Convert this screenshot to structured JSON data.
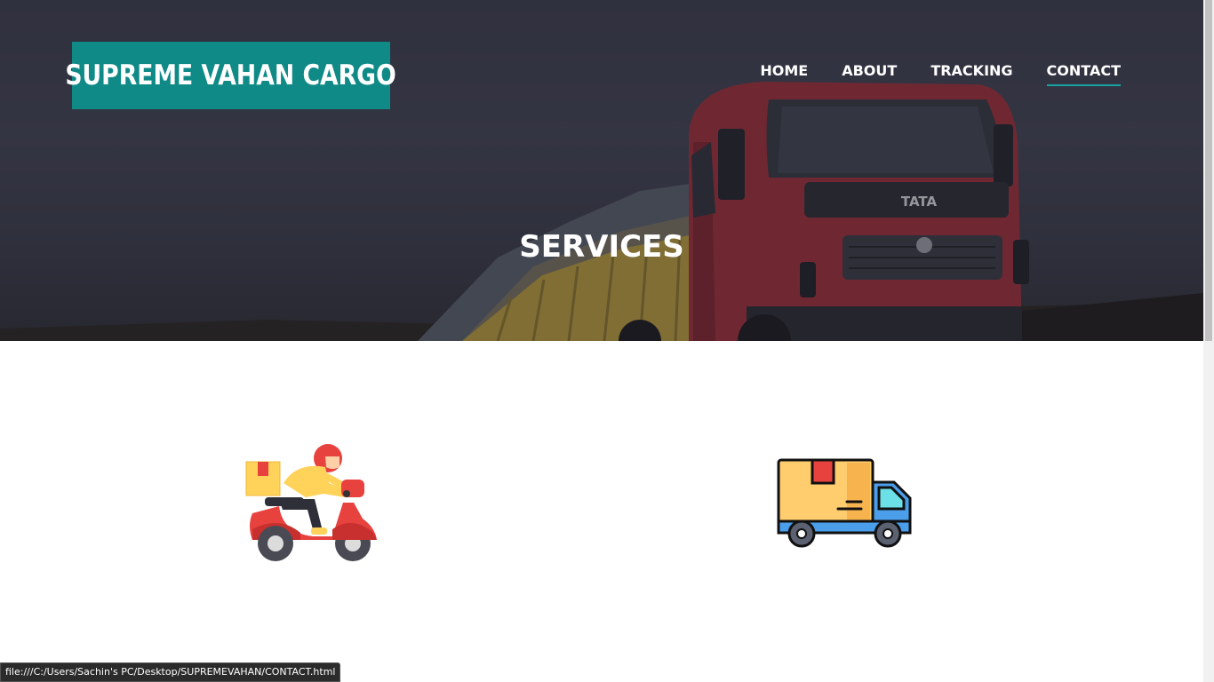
{
  "brand": {
    "title": "SUPREME VAHAN CARGO",
    "accent_color": "#0f8a87"
  },
  "nav": {
    "items": [
      {
        "label": "HOME",
        "active": false
      },
      {
        "label": "ABOUT",
        "active": false
      },
      {
        "label": "TRACKING",
        "active": false
      },
      {
        "label": "CONTACT",
        "active": true
      }
    ]
  },
  "hero": {
    "title": "SERVICES",
    "truck_badge": "TATA"
  },
  "services": [
    {
      "icon": "delivery-scooter-icon"
    },
    {
      "icon": "delivery-truck-icon"
    }
  ],
  "statusbar": {
    "url": "file:///C:/Users/Sachin's PC/Desktop/SUPREMEVAHAN/CONTACT.html"
  }
}
